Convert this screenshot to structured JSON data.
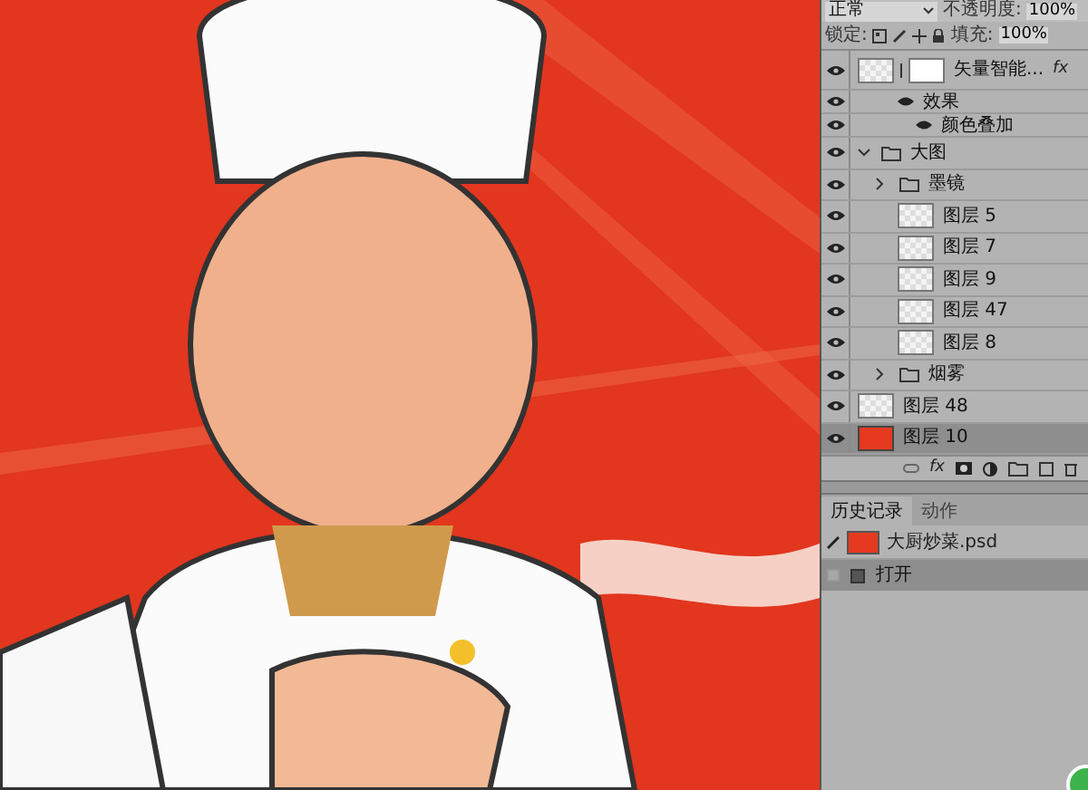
{
  "layers_panel": {
    "blend_mode": "正常",
    "opacity_label": "不透明度:",
    "opacity": "100%",
    "lock_label": "锁定:",
    "fill_label": "填充:",
    "fill": "100%",
    "layers": [
      {
        "kind": "smart",
        "name": "矢量智能...",
        "fx": "fx",
        "visible": true,
        "selected": false,
        "children": [
          {
            "kind": "effects",
            "name": "效果",
            "visible": true,
            "selected": false,
            "children": [
              {
                "kind": "effect",
                "name": "颜色叠加",
                "visible": true,
                "selected": false
              }
            ]
          }
        ]
      },
      {
        "kind": "group",
        "name": "大图",
        "expanded": true,
        "visible": true,
        "selected": false,
        "children": [
          {
            "kind": "group",
            "name": "墨镜",
            "expanded": false,
            "visible": true,
            "selected": false
          },
          {
            "kind": "layer",
            "name": "图层 5",
            "visible": true,
            "selected": false
          },
          {
            "kind": "layer",
            "name": "图层 7",
            "visible": true,
            "selected": false
          },
          {
            "kind": "layer",
            "name": "图层 9",
            "visible": true,
            "selected": false
          },
          {
            "kind": "layer",
            "name": "图层 47",
            "visible": true,
            "selected": false
          },
          {
            "kind": "layer",
            "name": "图层 8",
            "visible": true,
            "selected": false
          },
          {
            "kind": "group",
            "name": "烟雾",
            "expanded": false,
            "visible": true,
            "selected": false
          }
        ]
      },
      {
        "kind": "layer",
        "name": "图层 48",
        "visible": true,
        "selected": false
      },
      {
        "kind": "layer",
        "name": "图层 10",
        "color": "#e53a20",
        "visible": true,
        "selected": true
      }
    ],
    "toolbar_fx": "fx"
  },
  "history_panel": {
    "tabs": [
      {
        "label": "历史记录",
        "selected": true
      },
      {
        "label": "动作",
        "selected": false
      }
    ],
    "snapshot": {
      "name": "大厨炒菜.psd"
    },
    "states": [
      {
        "label": "打开",
        "selected": true
      }
    ]
  }
}
